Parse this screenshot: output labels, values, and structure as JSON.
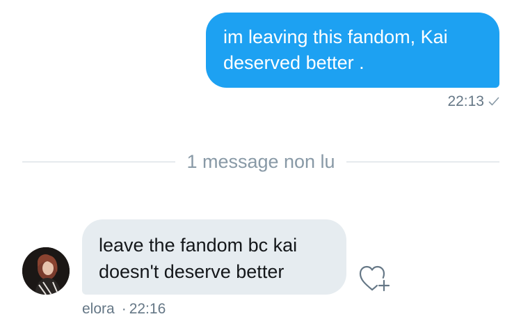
{
  "sent": {
    "text_line1": "im leaving this fandom, Kai",
    "text_line2": "deserved better .",
    "time": "22:13",
    "status_icon": "check-icon"
  },
  "divider": {
    "label": "1 message non lu"
  },
  "received": {
    "text_line1": "leave the fandom bc kai",
    "text_line2": "doesn't deserve better",
    "sender": "elora",
    "separator": "·",
    "time": "22:16",
    "reaction_icon": "heart-plus-icon"
  },
  "colors": {
    "sent_bubble": "#1da1f2",
    "received_bubble": "#e6ecf0",
    "meta_text": "#657786",
    "divider_text": "#8899a6"
  }
}
